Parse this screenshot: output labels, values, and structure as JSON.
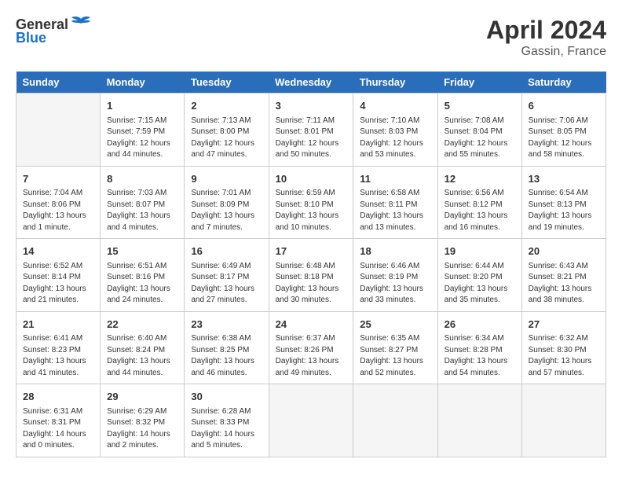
{
  "header": {
    "logo_general": "General",
    "logo_blue": "Blue",
    "title": "April 2024",
    "subtitle": "Gassin, France"
  },
  "calendar": {
    "days_of_week": [
      "Sunday",
      "Monday",
      "Tuesday",
      "Wednesday",
      "Thursday",
      "Friday",
      "Saturday"
    ],
    "weeks": [
      [
        {
          "day": "",
          "info": ""
        },
        {
          "day": "1",
          "info": "Sunrise: 7:15 AM\nSunset: 7:59 PM\nDaylight: 12 hours\nand 44 minutes."
        },
        {
          "day": "2",
          "info": "Sunrise: 7:13 AM\nSunset: 8:00 PM\nDaylight: 12 hours\nand 47 minutes."
        },
        {
          "day": "3",
          "info": "Sunrise: 7:11 AM\nSunset: 8:01 PM\nDaylight: 12 hours\nand 50 minutes."
        },
        {
          "day": "4",
          "info": "Sunrise: 7:10 AM\nSunset: 8:03 PM\nDaylight: 12 hours\nand 53 minutes."
        },
        {
          "day": "5",
          "info": "Sunrise: 7:08 AM\nSunset: 8:04 PM\nDaylight: 12 hours\nand 55 minutes."
        },
        {
          "day": "6",
          "info": "Sunrise: 7:06 AM\nSunset: 8:05 PM\nDaylight: 12 hours\nand 58 minutes."
        }
      ],
      [
        {
          "day": "7",
          "info": "Sunrise: 7:04 AM\nSunset: 8:06 PM\nDaylight: 13 hours\nand 1 minute."
        },
        {
          "day": "8",
          "info": "Sunrise: 7:03 AM\nSunset: 8:07 PM\nDaylight: 13 hours\nand 4 minutes."
        },
        {
          "day": "9",
          "info": "Sunrise: 7:01 AM\nSunset: 8:09 PM\nDaylight: 13 hours\nand 7 minutes."
        },
        {
          "day": "10",
          "info": "Sunrise: 6:59 AM\nSunset: 8:10 PM\nDaylight: 13 hours\nand 10 minutes."
        },
        {
          "day": "11",
          "info": "Sunrise: 6:58 AM\nSunset: 8:11 PM\nDaylight: 13 hours\nand 13 minutes."
        },
        {
          "day": "12",
          "info": "Sunrise: 6:56 AM\nSunset: 8:12 PM\nDaylight: 13 hours\nand 16 minutes."
        },
        {
          "day": "13",
          "info": "Sunrise: 6:54 AM\nSunset: 8:13 PM\nDaylight: 13 hours\nand 19 minutes."
        }
      ],
      [
        {
          "day": "14",
          "info": "Sunrise: 6:52 AM\nSunset: 8:14 PM\nDaylight: 13 hours\nand 21 minutes."
        },
        {
          "day": "15",
          "info": "Sunrise: 6:51 AM\nSunset: 8:16 PM\nDaylight: 13 hours\nand 24 minutes."
        },
        {
          "day": "16",
          "info": "Sunrise: 6:49 AM\nSunset: 8:17 PM\nDaylight: 13 hours\nand 27 minutes."
        },
        {
          "day": "17",
          "info": "Sunrise: 6:48 AM\nSunset: 8:18 PM\nDaylight: 13 hours\nand 30 minutes."
        },
        {
          "day": "18",
          "info": "Sunrise: 6:46 AM\nSunset: 8:19 PM\nDaylight: 13 hours\nand 33 minutes."
        },
        {
          "day": "19",
          "info": "Sunrise: 6:44 AM\nSunset: 8:20 PM\nDaylight: 13 hours\nand 35 minutes."
        },
        {
          "day": "20",
          "info": "Sunrise: 6:43 AM\nSunset: 8:21 PM\nDaylight: 13 hours\nand 38 minutes."
        }
      ],
      [
        {
          "day": "21",
          "info": "Sunrise: 6:41 AM\nSunset: 8:23 PM\nDaylight: 13 hours\nand 41 minutes."
        },
        {
          "day": "22",
          "info": "Sunrise: 6:40 AM\nSunset: 8:24 PM\nDaylight: 13 hours\nand 44 minutes."
        },
        {
          "day": "23",
          "info": "Sunrise: 6:38 AM\nSunset: 8:25 PM\nDaylight: 13 hours\nand 46 minutes."
        },
        {
          "day": "24",
          "info": "Sunrise: 6:37 AM\nSunset: 8:26 PM\nDaylight: 13 hours\nand 49 minutes."
        },
        {
          "day": "25",
          "info": "Sunrise: 6:35 AM\nSunset: 8:27 PM\nDaylight: 13 hours\nand 52 minutes."
        },
        {
          "day": "26",
          "info": "Sunrise: 6:34 AM\nSunset: 8:28 PM\nDaylight: 13 hours\nand 54 minutes."
        },
        {
          "day": "27",
          "info": "Sunrise: 6:32 AM\nSunset: 8:30 PM\nDaylight: 13 hours\nand 57 minutes."
        }
      ],
      [
        {
          "day": "28",
          "info": "Sunrise: 6:31 AM\nSunset: 8:31 PM\nDaylight: 14 hours\nand 0 minutes."
        },
        {
          "day": "29",
          "info": "Sunrise: 6:29 AM\nSunset: 8:32 PM\nDaylight: 14 hours\nand 2 minutes."
        },
        {
          "day": "30",
          "info": "Sunrise: 6:28 AM\nSunset: 8:33 PM\nDaylight: 14 hours\nand 5 minutes."
        },
        {
          "day": "",
          "info": ""
        },
        {
          "day": "",
          "info": ""
        },
        {
          "day": "",
          "info": ""
        },
        {
          "day": "",
          "info": ""
        }
      ]
    ]
  }
}
